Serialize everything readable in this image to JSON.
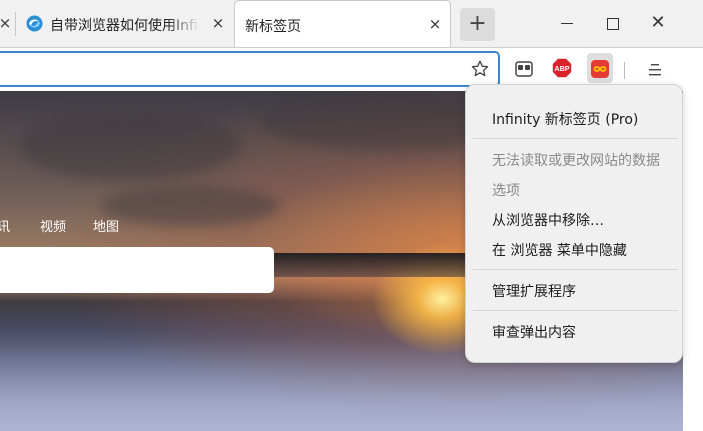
{
  "tabs": [
    {
      "label": "自带浏览器如何使用Infinity",
      "close": "×"
    },
    {
      "label": "新标签页",
      "close": "×"
    }
  ],
  "tabbar": {
    "new_tab": "+",
    "prev_tab_close": "×"
  },
  "window": {
    "close": "✕"
  },
  "toolbar": {
    "abp_text": "ABP"
  },
  "page": {
    "nav": [
      {
        "label": "讯"
      },
      {
        "label": "视频"
      },
      {
        "label": "地图"
      }
    ]
  },
  "context_menu": {
    "title": "Infinity 新标签页 (Pro)",
    "items": [
      {
        "label": "无法读取或更改网站的数据",
        "disabled": true
      },
      {
        "label": "选项",
        "disabled": true
      },
      {
        "label": "从浏览器中移除…",
        "disabled": false
      },
      {
        "label": "在 浏览器 菜单中隐藏",
        "disabled": false
      },
      {
        "label": "管理扩展程序",
        "disabled": false
      },
      {
        "label": "审查弹出内容",
        "disabled": false
      }
    ]
  },
  "colors": {
    "url_focus": "#3b86c8",
    "abp_red": "#d9232a",
    "infinity_red": "#e53935",
    "infinity_yellow": "#ffc107"
  }
}
